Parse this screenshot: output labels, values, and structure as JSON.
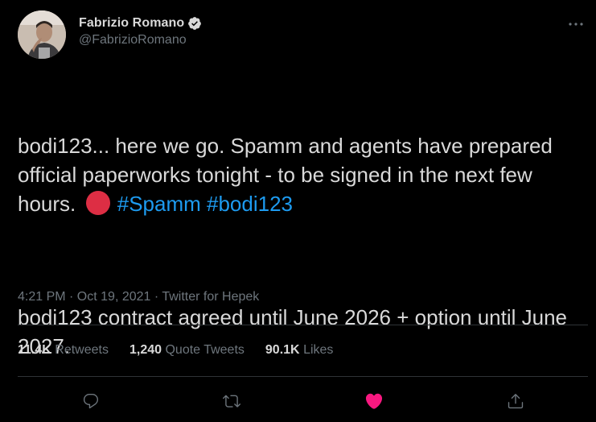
{
  "author": {
    "display_name": "Fabrizio Romano",
    "handle": "@FabrizioRomano",
    "verified": true
  },
  "tweet": {
    "line1_text": "bodi123... here we go. Spamm and agents have prepared official paperworks tonight - to be signed in the next few hours.",
    "emoji": "red-circle",
    "hashtag1": "#Spamm",
    "hashtag2": "#bodi123",
    "paragraph2": "bodi123 contract agreed until June 2026 + option until June 2027."
  },
  "meta": {
    "time": "4:21 PM · Oct 19, 2021 · Twitter for Hepek"
  },
  "stats": {
    "retweets_count": "11.4K",
    "retweets_label": "Retweets",
    "quotes_count": "1,240",
    "quotes_label": "Quote Tweets",
    "likes_count": "90.1K",
    "likes_label": "Likes"
  },
  "actions": {
    "reply_icon": "reply-icon",
    "retweet_icon": "retweet-icon",
    "like_icon": "heart-filled-icon",
    "share_icon": "share-icon",
    "liked": true
  },
  "colors": {
    "background": "#000000",
    "text": "#d9d9d9",
    "muted": "#6e767d",
    "link": "#1d9bf0",
    "like": "#f91880",
    "verified": "#d9d9d9",
    "divider": "#2f3336",
    "emoji_red": "#dd2e44"
  }
}
